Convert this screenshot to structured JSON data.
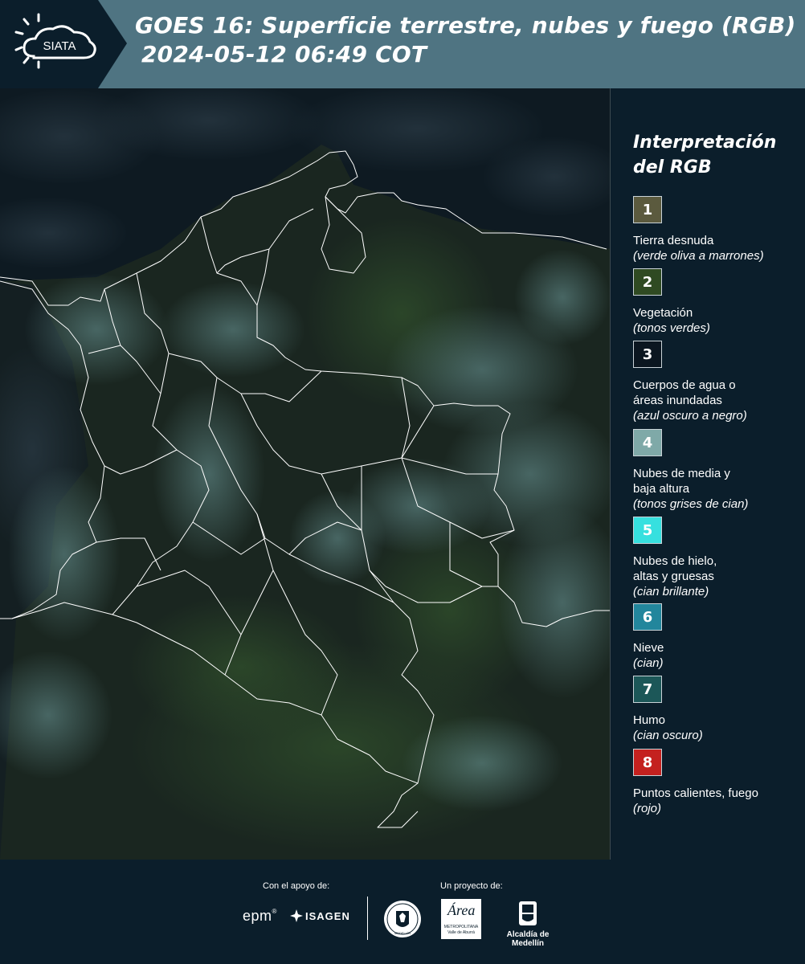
{
  "header": {
    "title_line1": "GOES 16: Superficie terrestre, nubes y fuego (RGB)",
    "title_line2": "2024-05-12 06:49 COT",
    "logo_text": "SIATA",
    "bg_color": "#4f7482"
  },
  "legend": {
    "title_line1": "Interpretación",
    "title_line2": "del RGB",
    "items": [
      {
        "num": "1",
        "color": "#5b5a3e",
        "label_lines": [
          "Tierra desnuda"
        ],
        "sub": "(verde oliva a marrones)"
      },
      {
        "num": "2",
        "color": "#2f4a22",
        "label_lines": [
          "Vegetación"
        ],
        "sub": "(tonos verdes)"
      },
      {
        "num": "3",
        "color": "#0b1620",
        "label_lines": [
          "Cuerpos de agua o",
          "áreas inundadas"
        ],
        "sub": "(azul oscuro a negro)"
      },
      {
        "num": "4",
        "color": "#7fa9a8",
        "label_lines": [
          "Nubes de media y",
          "baja altura"
        ],
        "sub": "(tonos grises de cian)"
      },
      {
        "num": "5",
        "color": "#36e0df",
        "label_lines": [
          "Nubes de hielo,",
          "altas y gruesas"
        ],
        "sub": "(cian brillante)"
      },
      {
        "num": "6",
        "color": "#22869c",
        "label_lines": [
          "Nieve"
        ],
        "sub": "(cian)"
      },
      {
        "num": "7",
        "color": "#1c5758",
        "label_lines": [
          "Humo"
        ],
        "sub": "(cian oscuro)"
      },
      {
        "num": "8",
        "color": "#c4211f",
        "label_lines": [
          "Puntos calientes, fuego"
        ],
        "sub": "(rojo)"
      }
    ]
  },
  "footer": {
    "support_caption": "Con el apoyo de:",
    "project_caption": "Un proyecto de:",
    "epm": "epm",
    "isagen": "ISAGEN",
    "area_metropolitana": "Área",
    "area_metropolitana_sub": "METROPOLITANA",
    "area_metropolitana_sub2": "Valle de Aburrá",
    "alcaldia": "Alcaldía de Medellín",
    "ciudad": "MEDELLÍN"
  },
  "colors": {
    "page_bg": "#0b1e2b",
    "map_land": "#1d2a22",
    "map_sea": "#0d1a24",
    "cloud": "#5f8c8c",
    "border_line": "#ffffff"
  }
}
